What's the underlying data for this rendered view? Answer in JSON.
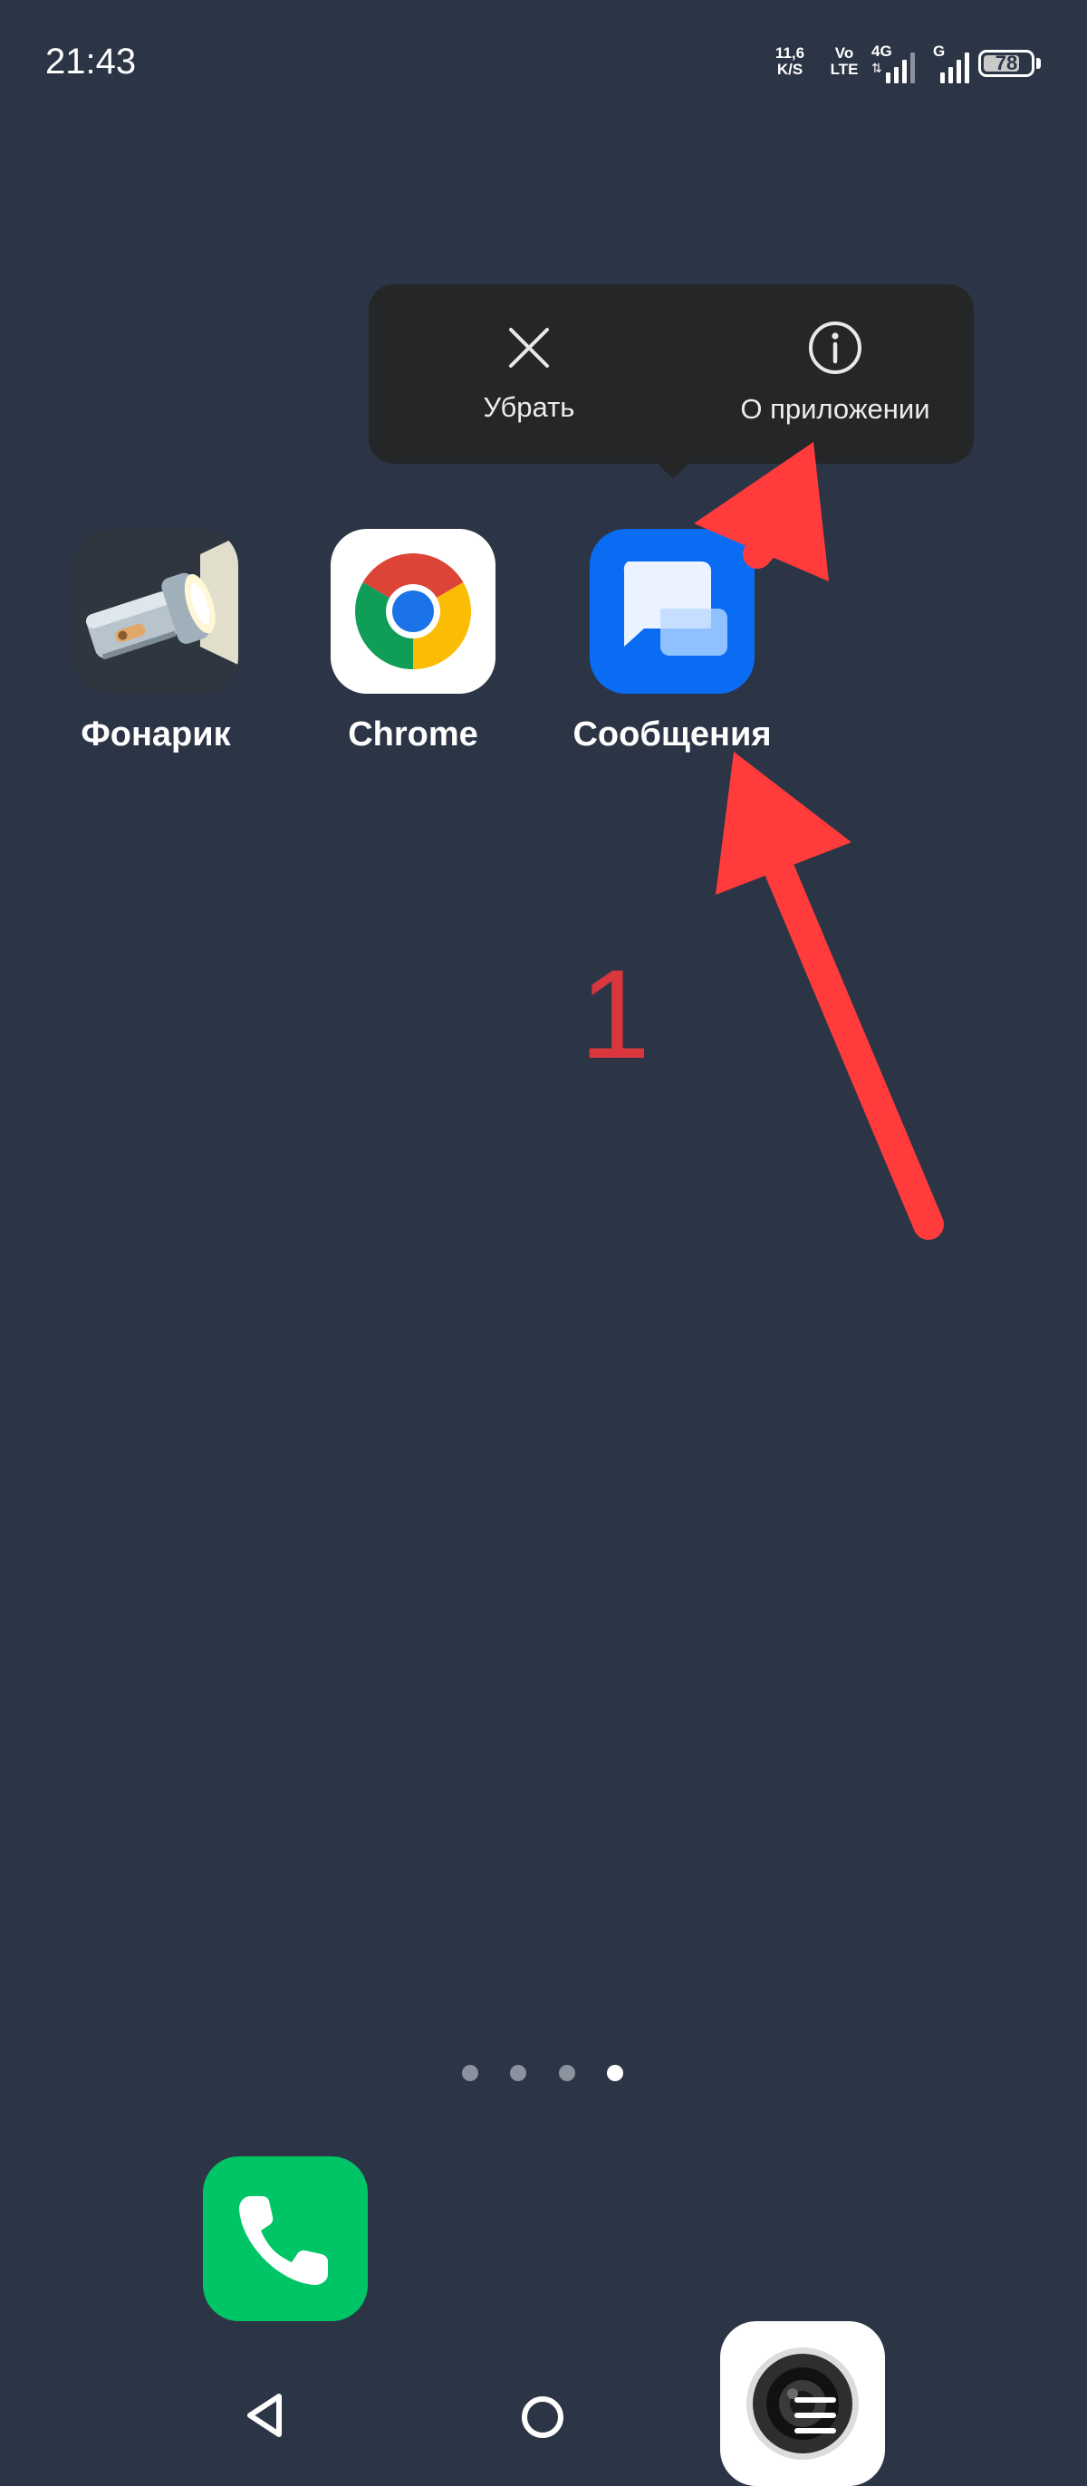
{
  "status_bar": {
    "time": "21:43",
    "net_speed_value": "11,6",
    "net_speed_unit": "K/S",
    "volte_top": "Vo",
    "volte_bottom": "LTE",
    "network_4g": "4G",
    "network_g": "G",
    "battery": "78",
    "battery_level_percent": 78
  },
  "popup": {
    "items": [
      {
        "label": "Убрать",
        "icon": "close-icon"
      },
      {
        "label": "О приложении",
        "icon": "info-icon"
      }
    ]
  },
  "apps": [
    {
      "label": "Фонарик",
      "icon": "flashlight-icon"
    },
    {
      "label": "Chrome",
      "icon": "chrome-icon"
    },
    {
      "label": "Сообщения",
      "icon": "messages-icon"
    }
  ],
  "annotation": {
    "number": "1",
    "color": "#ff3b3b"
  },
  "page_indicator": {
    "count": 4,
    "active_page": 4
  },
  "dock": [
    {
      "icon": "phone-icon",
      "color": "#00c566"
    },
    {
      "icon": "camera-icon",
      "color": "#ffffff"
    }
  ],
  "nav_bar": {
    "icons": [
      "back-icon",
      "home-icon",
      "menu-icon"
    ]
  }
}
